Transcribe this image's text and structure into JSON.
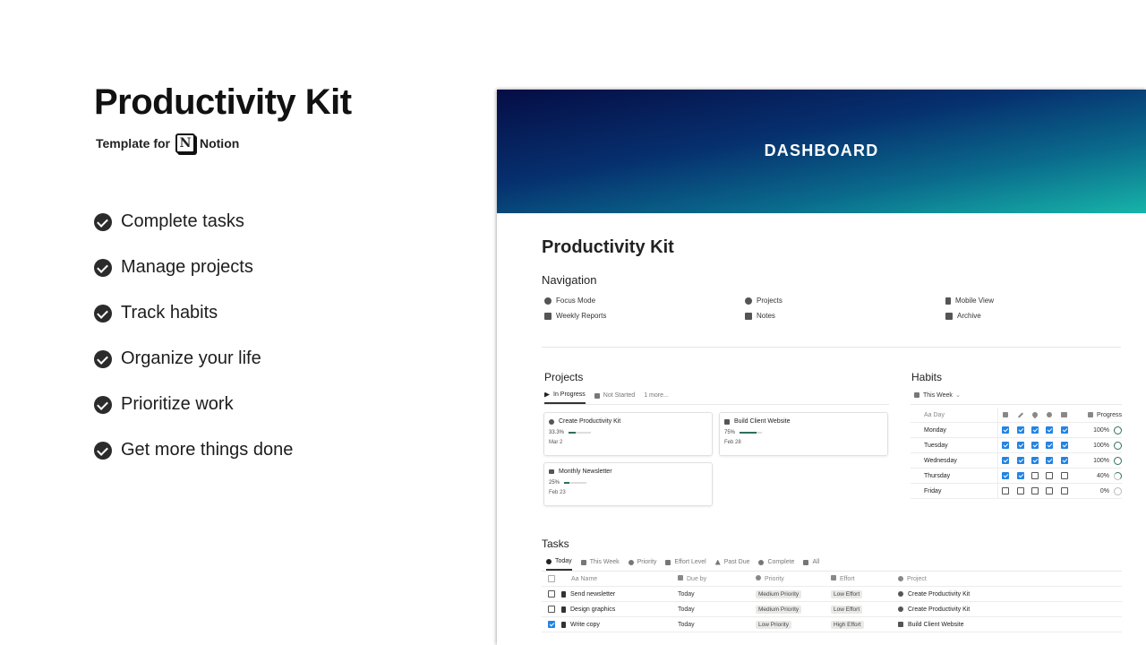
{
  "hero": {
    "title": "Productivity Kit",
    "template_for": "Template for",
    "notion_label": "Notion",
    "notion_logo_letter": "N",
    "features": [
      "Complete tasks",
      "Manage projects",
      "Track habits",
      "Organize your life",
      "Prioritize work",
      "Get more things done"
    ]
  },
  "page": {
    "cover_title": "DASHBOARD",
    "title": "Productivity Kit",
    "navigation": {
      "heading": "Navigation",
      "items": [
        {
          "label": "Focus Mode",
          "icon": "check-circle-icon"
        },
        {
          "label": "Weekly Reports",
          "icon": "calendar-icon"
        },
        {
          "label": "Projects",
          "icon": "pin-icon"
        },
        {
          "label": "Notes",
          "icon": "folder-icon"
        },
        {
          "label": "Mobile View",
          "icon": "phone-icon"
        },
        {
          "label": "Archive",
          "icon": "archive-icon"
        }
      ]
    },
    "projects": {
      "heading": "Projects",
      "tabs": [
        "In Progress",
        "Not Started",
        "1 more..."
      ],
      "cards": [
        {
          "title": "Create Productivity Kit",
          "progress": "33.3%",
          "progress_value": 0.333,
          "date": "Mar 2"
        },
        {
          "title": "Build Client Website",
          "progress": "75%",
          "progress_value": 0.75,
          "date": "Feb 28"
        },
        {
          "title": "Monthly Newsletter",
          "progress": "25%",
          "progress_value": 0.25,
          "date": "Feb 23"
        }
      ]
    },
    "habits": {
      "heading": "Habits",
      "view": "This Week",
      "col_day": "Aa Day",
      "col_progress": "Progress",
      "rows": [
        {
          "day": "Monday",
          "checks": [
            true,
            true,
            true,
            true,
            true
          ],
          "progress": "100%"
        },
        {
          "day": "Tuesday",
          "checks": [
            true,
            true,
            true,
            true,
            true
          ],
          "progress": "100%"
        },
        {
          "day": "Wednesday",
          "checks": [
            true,
            true,
            true,
            true,
            true
          ],
          "progress": "100%"
        },
        {
          "day": "Thursday",
          "checks": [
            true,
            true,
            false,
            false,
            false
          ],
          "progress": "40%"
        },
        {
          "day": "Friday",
          "checks": [
            false,
            false,
            false,
            false,
            false
          ],
          "progress": "0%"
        }
      ]
    },
    "tasks": {
      "heading": "Tasks",
      "tabs": [
        "Today",
        "This Week",
        "Priority",
        "Effort Level",
        "Past Due",
        "Complete",
        "All"
      ],
      "columns": {
        "name": "Aa Name",
        "due": "Due by",
        "priority": "Priority",
        "effort": "Effort",
        "project": "Project"
      },
      "rows": [
        {
          "done": false,
          "name": "Send newsletter",
          "due": "Today",
          "priority": "Medium Priority",
          "effort": "Low Effort",
          "project": "Create Productivity Kit"
        },
        {
          "done": false,
          "name": "Design graphics",
          "due": "Today",
          "priority": "Medium Priority",
          "effort": "Low Effort",
          "project": "Create Productivity Kit"
        },
        {
          "done": true,
          "name": "Write copy",
          "due": "Today",
          "priority": "Low Priority",
          "effort": "High Effort",
          "project": "Build Client Website"
        }
      ]
    }
  }
}
